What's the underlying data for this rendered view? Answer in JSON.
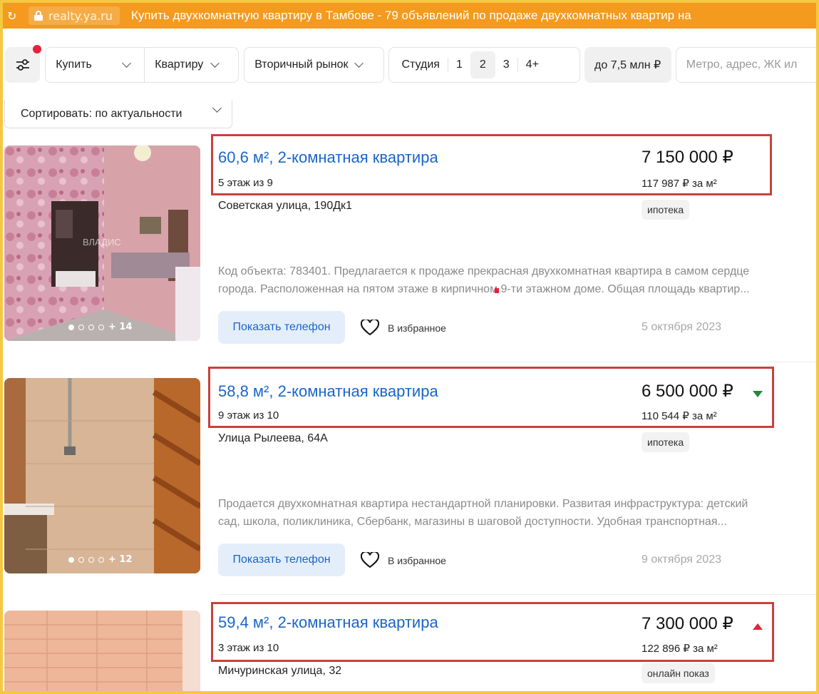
{
  "browser": {
    "url": "realty.ya.ru",
    "page_title": "Купить двухкомнатную квартиру в Тамбове - 79 объявлений по продаже двухкомнатных квартир на"
  },
  "filters": {
    "deal_type": "Купить",
    "property_type": "Квартиру",
    "market": "Вторичный рынок",
    "rooms": [
      "Студия",
      "1",
      "2",
      "3",
      "4+"
    ],
    "rooms_selected": "2",
    "price": "до 7,5 млн ₽",
    "search_placeholder": "Метро, адрес, ЖК ил"
  },
  "sort": {
    "label": "Сортировать: по актуальности"
  },
  "listings": [
    {
      "title": "60,6 м², 2-комнатная квартира",
      "floor": "5 этаж из 9",
      "price": "7 150 000 ₽",
      "price_per_m": "117 987 ₽ за м²",
      "address": "Советская улица, 190Дк1",
      "tag": "ипотека",
      "desc_line1": "Код объекта: 783401. Предлагается к продаже прекрасная двухкомнатная квартира в самом сердце",
      "desc_line2": "города. Расположенная на пятом этаже в кирпичном 9-ти этажном доме. Общая площадь квартир...",
      "phone_label": "Показать телефон",
      "fav_label": "В избранное",
      "date": "5 октября 2023",
      "photo_count": "+ 14",
      "price_change": "none",
      "watermark": "ВЛАДИС"
    },
    {
      "title": "58,8 м², 2-комнатная квартира",
      "floor": "9 этаж из 10",
      "price": "6 500 000 ₽",
      "price_per_m": "110 544 ₽ за м²",
      "address": "Улица Рылеева, 64А",
      "tag": "ипотека",
      "desc_line1": "Продается двухкомнатная квартира нестандартной планировки. Развитая инфраструктура: детский",
      "desc_line2": "сад, школа, поликлиника, Сбербанк, магазины в шаговой доступности. Удобная транспортная...",
      "phone_label": "Показать телефон",
      "fav_label": "В избранное",
      "date": "9 октября 2023",
      "photo_count": "+ 12",
      "price_change": "down"
    },
    {
      "title": "59,4 м², 2-комнатная квартира",
      "floor": "3 этаж из 10",
      "price": "7 300 000 ₽",
      "price_per_m": "122 896 ₽ за м²",
      "address": "Мичуринская улица, 32",
      "tag": "онлайн показ",
      "price_change": "up"
    }
  ],
  "colors": {
    "topbar": "#f39a1f",
    "frame": "#f5c842",
    "link": "#1a65c9",
    "highlight_box": "#c9413b",
    "price_down": "#1e8a3b",
    "price_up": "#e8203a"
  }
}
